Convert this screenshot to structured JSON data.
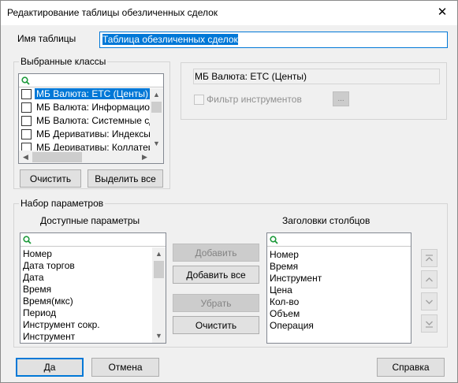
{
  "window": {
    "title": "Редактирование таблицы обезличенных сделок",
    "close_glyph": "✕"
  },
  "table_name": {
    "label": "Имя таблицы",
    "value": "Таблица обезличенных сделок"
  },
  "classes": {
    "legend": "Выбранные классы",
    "items": [
      {
        "label": "МБ Валюта: ЕТС (Центы)",
        "checked": false,
        "selected": true
      },
      {
        "label": "МБ Валюта: Информацион",
        "checked": false,
        "selected": false
      },
      {
        "label": "МБ Валюта: Системные сд",
        "checked": false,
        "selected": false
      },
      {
        "label": "МБ Деривативы: Индексы",
        "checked": false,
        "selected": false
      },
      {
        "label": "МБ Деривативы: Коллатер",
        "checked": false,
        "selected": false
      }
    ],
    "clear_button": "Очистить",
    "select_all_button": "Выделить все"
  },
  "class_detail": {
    "name": "МБ Валюта: ЕТС (Центы)",
    "filter_label": "Фильтр инструментов",
    "filter_button": "..."
  },
  "params": {
    "legend": "Набор параметров",
    "available_header": "Доступные параметры",
    "available": [
      "Номер",
      "Дата торгов",
      "Дата",
      "Время",
      "Время(мкс)",
      "Период",
      "Инструмент сокр.",
      "Инструмент"
    ],
    "columns_header": "Заголовки столбцов",
    "columns": [
      "Номер",
      "Время",
      "Инструмент",
      "Цена",
      "Кол-во",
      "Объем",
      "Операция"
    ],
    "add_button": "Добавить",
    "add_all_button": "Добавить все",
    "remove_button": "Убрать",
    "clear_button": "Очистить"
  },
  "footer": {
    "ok": "Да",
    "cancel": "Отмена",
    "help": "Справка"
  },
  "icons": {
    "search": "search-icon",
    "move_top": "move-top-icon",
    "move_up": "move-up-icon",
    "move_down": "move-down-icon",
    "move_bottom": "move-bottom-icon"
  },
  "colors": {
    "selection": "#0078d7",
    "search_icon": "#1e9a3c"
  }
}
